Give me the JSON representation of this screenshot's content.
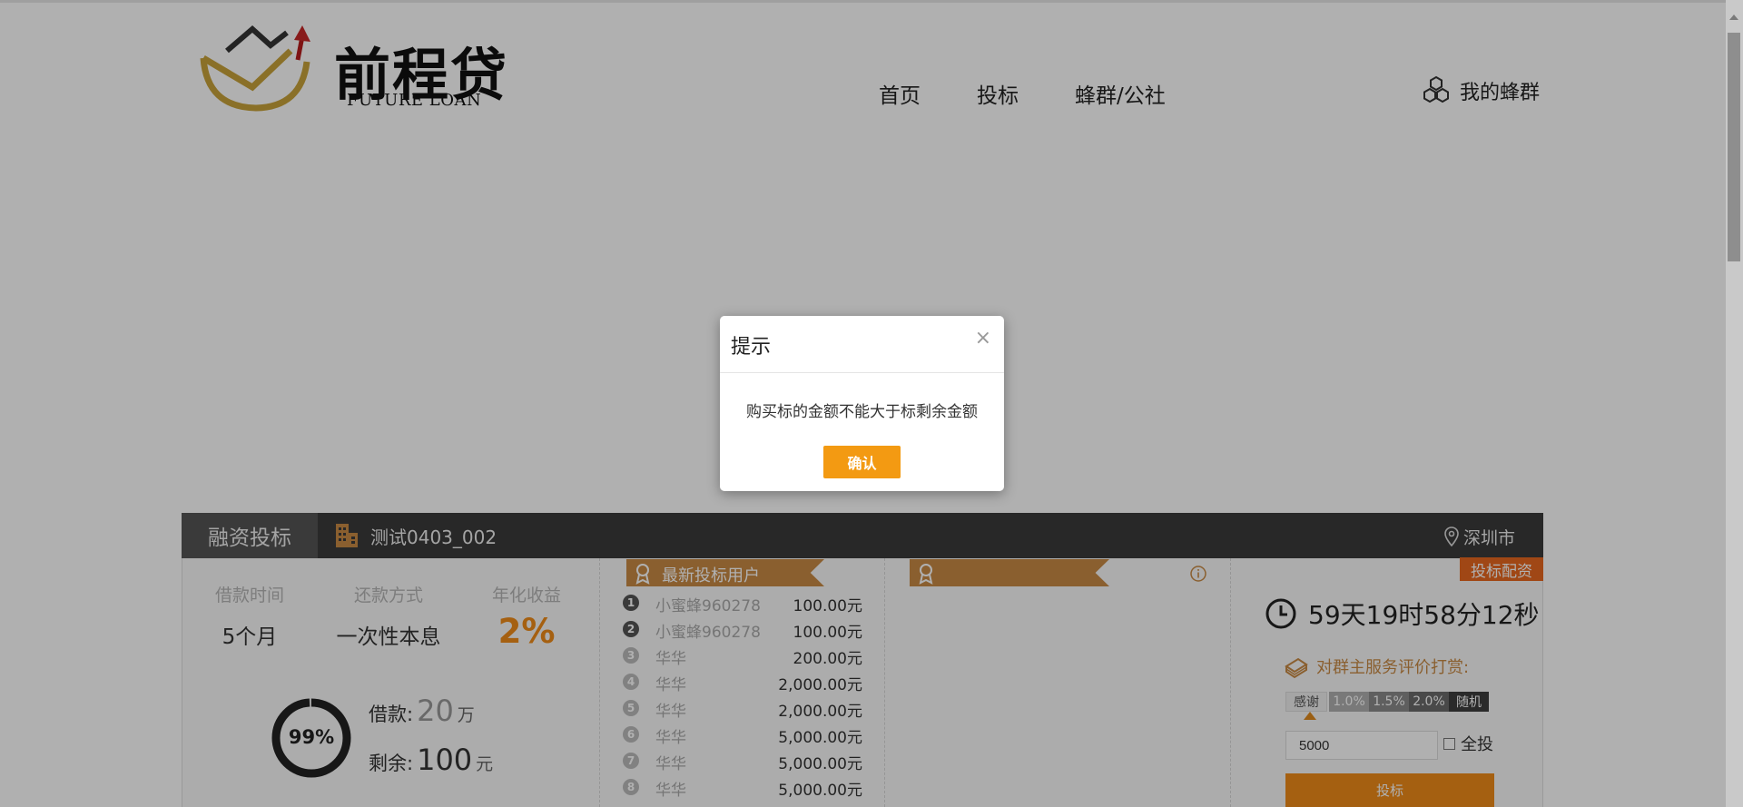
{
  "header": {
    "logo_text": "前程贷",
    "logo_subtitle": "FUTURE LOAN",
    "nav": {
      "home": "首页",
      "bid": "投标",
      "community": "蜂群/公社"
    },
    "my_hive": "我的蜂群"
  },
  "panel": {
    "tab_label": "融资投标",
    "project_name": "测试0403_002",
    "city": "深圳市",
    "stats": {
      "term_label": "借款时间",
      "term_value": "5个月",
      "repay_label": "还款方式",
      "repay_value": "一次性本息",
      "yield_label": "年化收益",
      "yield_value": "2%"
    },
    "progress_percent": 99,
    "progress_label": "99%",
    "loan_label": "借款:",
    "loan_amount": "20",
    "loan_unit": "万",
    "remaining_label": "剩余:",
    "remaining_amount": "100",
    "remaining_unit": "元"
  },
  "investors": {
    "title": "最新投标用户",
    "rows": [
      {
        "rank": "1",
        "name": "小蜜蜂960278",
        "amount": "100.00元"
      },
      {
        "rank": "2",
        "name": "小蜜蜂960278",
        "amount": "100.00元"
      },
      {
        "rank": "3",
        "name": "华华",
        "amount": "200.00元"
      },
      {
        "rank": "4",
        "name": "华华",
        "amount": "2,000.00元"
      },
      {
        "rank": "5",
        "name": "华华",
        "amount": "2,000.00元"
      },
      {
        "rank": "6",
        "name": "华华",
        "amount": "5,000.00元"
      },
      {
        "rank": "7",
        "name": "华华",
        "amount": "5,000.00元"
      },
      {
        "rank": "8",
        "name": "华华",
        "amount": "5,000.00元"
      }
    ]
  },
  "invest": {
    "alloc_badge": "投标配资",
    "countdown": "59天19时58分12秒",
    "tip_title": "对群主服务评价打赏:",
    "tip_options": {
      "thanks": "感谢",
      "p1": "1.0%",
      "p15": "1.5%",
      "p2": "2.0%",
      "random": "随机"
    },
    "amount_value": "5000",
    "all_in_label": "全投",
    "invest_button": "投标"
  },
  "dialog": {
    "title": "提示",
    "close": "×",
    "message": "购买标的金额不能大于标剩余金额",
    "confirm": "确认"
  },
  "colors": {
    "accent": "#f08c1a",
    "ribbon": "#c88a45",
    "dark_bar": "#3a3a3a",
    "confirm_button": "#f39a12"
  }
}
